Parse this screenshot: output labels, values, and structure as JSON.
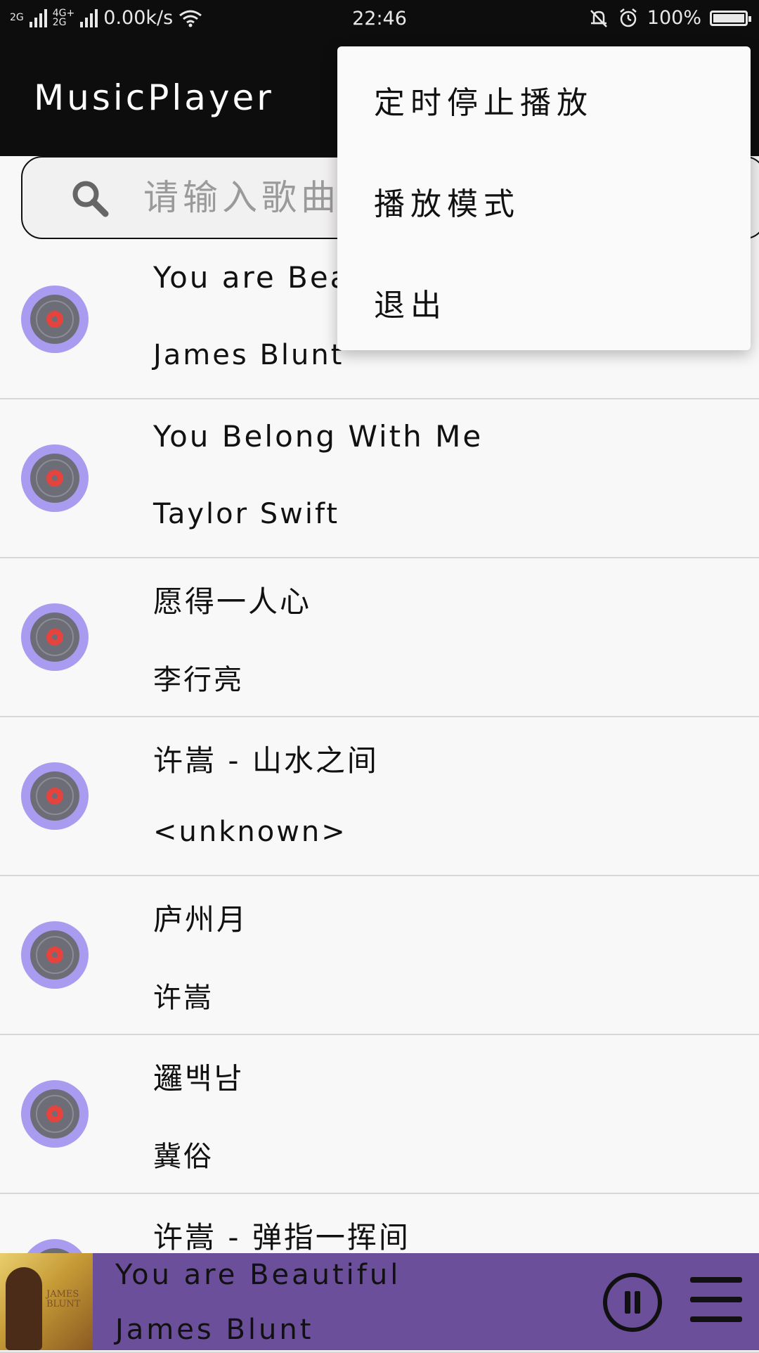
{
  "status_bar": {
    "net1": "2G",
    "net2_top": "4G+",
    "net2_bottom": "2G",
    "speed": "0.00k/s",
    "time": "22:46",
    "battery": "100%"
  },
  "app_bar": {
    "title": "MusicPlayer"
  },
  "search": {
    "placeholder": "请输入歌曲名"
  },
  "songs": [
    {
      "title": "You are Beautiful",
      "artist": "James Blunt"
    },
    {
      "title": "You Belong With Me",
      "artist": "Taylor Swift"
    },
    {
      "title": "愿得一人心",
      "artist": "李行亮"
    },
    {
      "title": "许嵩 - 山水之间",
      "artist": "<unknown>"
    },
    {
      "title": "庐州月",
      "artist": "许嵩"
    },
    {
      "title": "邏백남",
      "artist": "冀俗"
    },
    {
      "title": "许嵩 - 弹指一挥间",
      "artist": ""
    }
  ],
  "menu": {
    "items": [
      "定时停止播放",
      "播放模式",
      "退出"
    ]
  },
  "player": {
    "title": "You are Beautiful",
    "artist": "James Blunt",
    "album_art_text": "JAMES BLUNT"
  },
  "colors": {
    "bar": "#0d0d0d",
    "player_bg": "#6b4f9b",
    "disc": "#a99bf0",
    "disc_center": "#e5443e"
  },
  "icons": {
    "search": "search-icon",
    "disc": "disc-icon",
    "pause": "pause-icon",
    "playlist": "playlist-icon"
  }
}
